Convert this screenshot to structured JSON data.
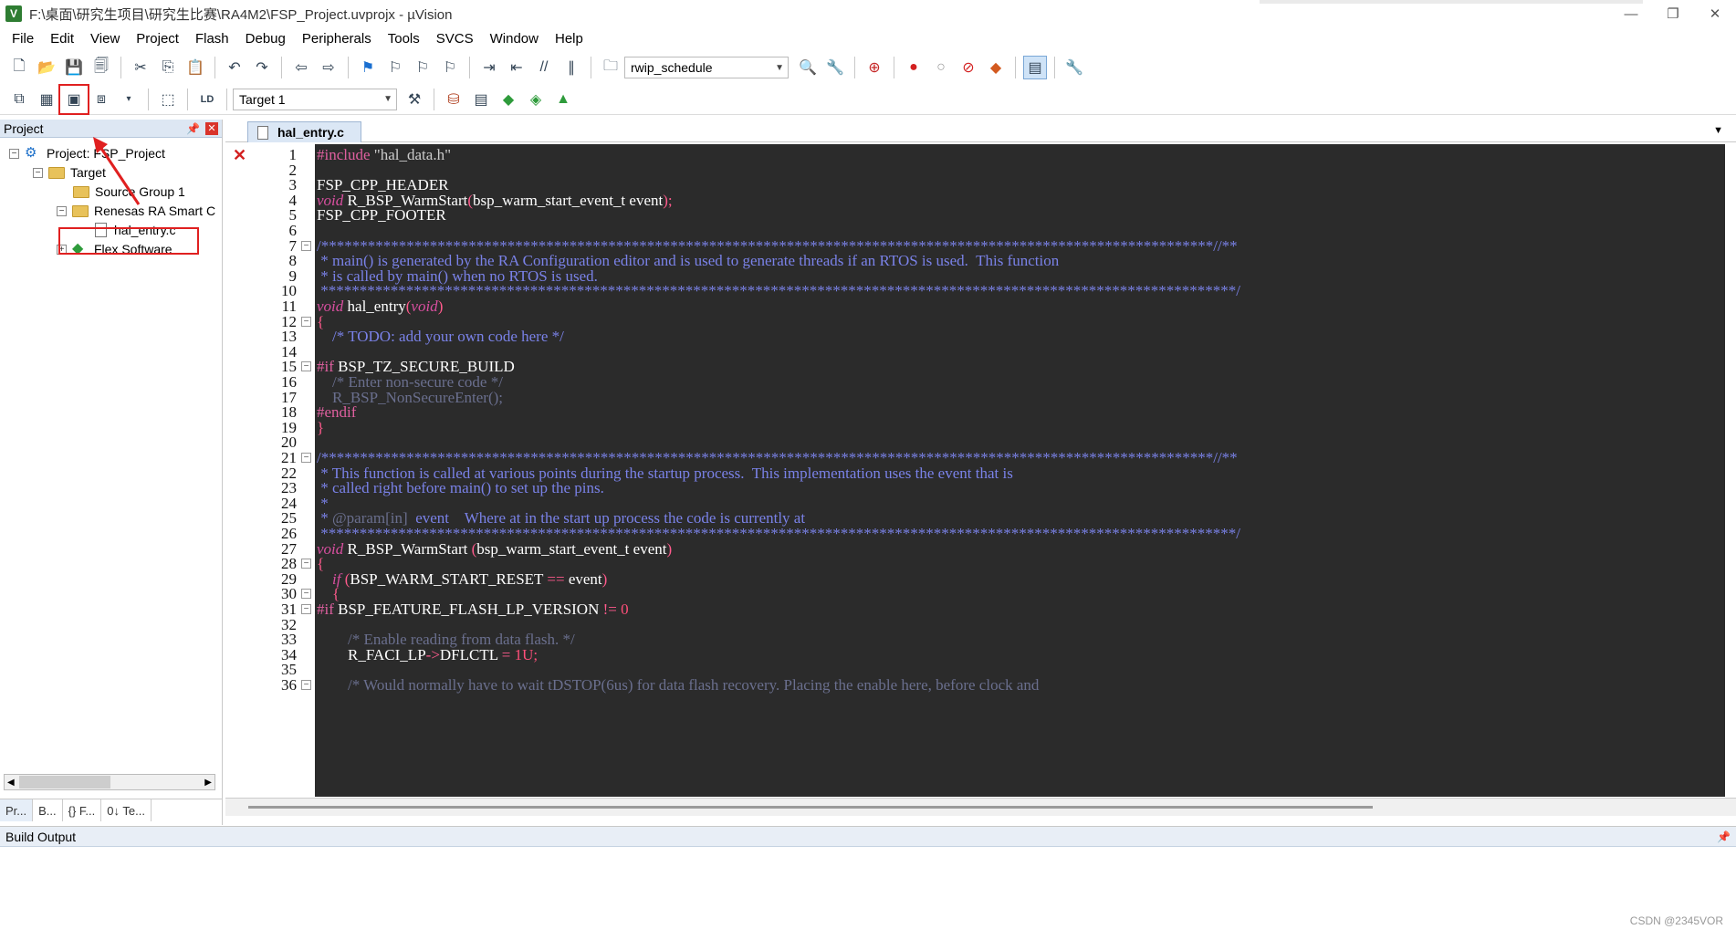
{
  "window": {
    "title": "F:\\桌面\\研究生项目\\研究生比赛\\RA4M2\\FSP_Project.uvprojx - µVision",
    "icon": "V",
    "controls": [
      "—",
      "❐",
      "✕"
    ]
  },
  "menu": [
    "File",
    "Edit",
    "View",
    "Project",
    "Flash",
    "Debug",
    "Peripherals",
    "Tools",
    "SVCS",
    "Window",
    "Help"
  ],
  "toolbar1": {
    "find_combo": "rwip_schedule"
  },
  "toolbar2": {
    "target_combo": "Target 1"
  },
  "project_pane": {
    "title": "Project",
    "pin": "📌",
    "close": "✕",
    "tree": [
      {
        "label": "Project: FSP_Project",
        "expander": "−"
      },
      {
        "label": "Target",
        "expander": "−"
      },
      {
        "label": "Source Group 1"
      },
      {
        "label": "Renesas RA Smart C",
        "expander": "−"
      },
      {
        "label": "hal_entry.c"
      },
      {
        "label": "Flex Software",
        "expander": "+"
      }
    ],
    "tabs": [
      "Pr...",
      "B...",
      "{} F...",
      "0↓ Te..."
    ]
  },
  "editor": {
    "tab_label": "hal_entry.c",
    "lines": [
      {
        "n": "1",
        "segs": [
          {
            "t": "#include ",
            "c": "c-pre"
          },
          {
            "t": "\"hal_data.h\"",
            "c": "c-str"
          }
        ]
      },
      {
        "n": "2",
        "segs": []
      },
      {
        "n": "3",
        "segs": [
          {
            "t": "FSP_CPP_HEADER",
            "c": ""
          }
        ]
      },
      {
        "n": "4",
        "segs": [
          {
            "t": "void",
            "c": "c-kw"
          },
          {
            "t": " R_BSP_WarmStart",
            "c": ""
          },
          {
            "t": "(",
            "c": "c-op"
          },
          {
            "t": "bsp_warm_start_event_t event",
            "c": ""
          },
          {
            "t": ");",
            "c": "c-op"
          }
        ]
      },
      {
        "n": "5",
        "segs": [
          {
            "t": "FSP_CPP_FOOTER",
            "c": ""
          }
        ]
      },
      {
        "n": "6",
        "segs": []
      },
      {
        "n": "7",
        "fold": "−",
        "segs": [
          {
            "t": "/*******************************************************************************************************************//**",
            "c": "c-cmt"
          }
        ]
      },
      {
        "n": "8",
        "segs": [
          {
            "t": " * main() is generated by the RA Configuration editor and is used to generate threads if an RTOS is used.  This function",
            "c": "c-cmt"
          }
        ]
      },
      {
        "n": "9",
        "segs": [
          {
            "t": " * is called by main() when no RTOS is used.",
            "c": "c-cmt"
          }
        ]
      },
      {
        "n": "10",
        "segs": [
          {
            "t": " **********************************************************************************************************************/",
            "c": "c-cmt"
          }
        ]
      },
      {
        "n": "11",
        "segs": [
          {
            "t": "void",
            "c": "c-kw"
          },
          {
            "t": " hal_entry",
            "c": ""
          },
          {
            "t": "(",
            "c": "c-op"
          },
          {
            "t": "void",
            "c": "c-kw"
          },
          {
            "t": ")",
            "c": "c-op"
          }
        ]
      },
      {
        "n": "12",
        "fold": "−",
        "segs": [
          {
            "t": "{",
            "c": "c-op"
          }
        ]
      },
      {
        "n": "13",
        "segs": [
          {
            "t": "    /* TODO: add your own code here */",
            "c": "c-cmt"
          }
        ]
      },
      {
        "n": "14",
        "segs": []
      },
      {
        "n": "15",
        "fold": "−",
        "segs": [
          {
            "t": "#if",
            "c": "c-pre"
          },
          {
            "t": " BSP_TZ_SECURE_BUILD",
            "c": ""
          }
        ]
      },
      {
        "n": "16",
        "segs": [
          {
            "t": "    /* Enter non-secure code */",
            "c": "c-dim"
          }
        ]
      },
      {
        "n": "17",
        "segs": [
          {
            "t": "    R_BSP_NonSecureEnter",
            "c": "c-dim"
          },
          {
            "t": "();",
            "c": "c-dim"
          }
        ]
      },
      {
        "n": "18",
        "segs": [
          {
            "t": "#endif",
            "c": "c-pre"
          }
        ]
      },
      {
        "n": "19",
        "segs": [
          {
            "t": "}",
            "c": "c-op"
          }
        ]
      },
      {
        "n": "20",
        "segs": []
      },
      {
        "n": "21",
        "fold": "−",
        "segs": [
          {
            "t": "/*******************************************************************************************************************//**",
            "c": "c-cmt"
          }
        ]
      },
      {
        "n": "22",
        "segs": [
          {
            "t": " * This function is called at various points during the startup process.  This implementation uses the event that is",
            "c": "c-cmt"
          }
        ]
      },
      {
        "n": "23",
        "segs": [
          {
            "t": " * called right before main() to set up the pins.",
            "c": "c-cmt"
          }
        ]
      },
      {
        "n": "24",
        "segs": [
          {
            "t": " *",
            "c": "c-cmt"
          }
        ]
      },
      {
        "n": "25",
        "segs": [
          {
            "t": " * ",
            "c": "c-cmt"
          },
          {
            "t": "@param[in]",
            "c": "c-dim"
          },
          {
            "t": "  event    Where at in the start up process the code is currently at",
            "c": "c-cmt"
          }
        ]
      },
      {
        "n": "26",
        "segs": [
          {
            "t": " **********************************************************************************************************************/",
            "c": "c-cmt"
          }
        ]
      },
      {
        "n": "27",
        "segs": [
          {
            "t": "void",
            "c": "c-kw"
          },
          {
            "t": " R_BSP_WarmStart ",
            "c": ""
          },
          {
            "t": "(",
            "c": "c-op"
          },
          {
            "t": "bsp_warm_start_event_t event",
            "c": ""
          },
          {
            "t": ")",
            "c": "c-op"
          }
        ]
      },
      {
        "n": "28",
        "fold": "−",
        "segs": [
          {
            "t": "{",
            "c": "c-op"
          }
        ]
      },
      {
        "n": "29",
        "segs": [
          {
            "t": "    ",
            "c": ""
          },
          {
            "t": "if",
            "c": "c-kw"
          },
          {
            "t": " (",
            "c": "c-op"
          },
          {
            "t": "BSP_WARM_START_RESET ",
            "c": ""
          },
          {
            "t": "==",
            "c": "c-op"
          },
          {
            "t": " event",
            "c": ""
          },
          {
            "t": ")",
            "c": "c-op"
          }
        ]
      },
      {
        "n": "30",
        "fold": "−",
        "segs": [
          {
            "t": "    {",
            "c": "c-op"
          }
        ]
      },
      {
        "n": "31",
        "fold": "−",
        "segs": [
          {
            "t": "#if",
            "c": "c-pre"
          },
          {
            "t": " BSP_FEATURE_FLASH_LP_VERSION ",
            "c": ""
          },
          {
            "t": "!=",
            "c": "c-op"
          },
          {
            "t": " 0",
            "c": "c-num"
          }
        ]
      },
      {
        "n": "32",
        "segs": []
      },
      {
        "n": "33",
        "segs": [
          {
            "t": "        /* Enable reading from data flash. */",
            "c": "c-dim"
          }
        ]
      },
      {
        "n": "34",
        "segs": [
          {
            "t": "        R_FACI_LP",
            "c": ""
          },
          {
            "t": "->",
            "c": "c-op"
          },
          {
            "t": "DFLCTL ",
            "c": ""
          },
          {
            "t": "=",
            "c": "c-op"
          },
          {
            "t": " 1U;",
            "c": "c-num"
          }
        ]
      },
      {
        "n": "35",
        "segs": []
      },
      {
        "n": "36",
        "fold": "−",
        "segs": [
          {
            "t": "        /* Would normally have to wait tDSTOP(6us) for data flash recovery. Placing the enable here, before clock and",
            "c": "c-dim"
          }
        ]
      }
    ]
  },
  "build_output": {
    "title": "Build Output",
    "pin": "📌"
  },
  "watermark": "CSDN @2345VOR",
  "colors": {
    "editor_bg": "#2b2b2b",
    "annotation_red": "#e02020"
  }
}
